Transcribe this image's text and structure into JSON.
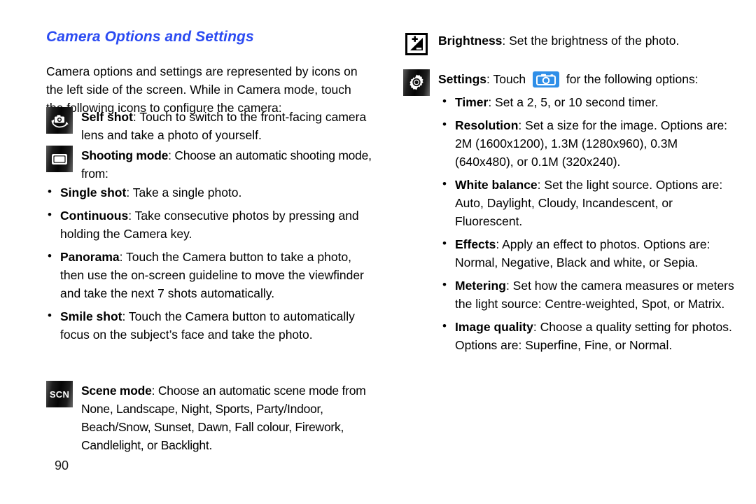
{
  "document": {
    "heading": "Camera Options and Settings",
    "page_number": "90"
  },
  "left_column": {
    "intro": "Camera options and settings are represented by icons on the left side of the screen. While in Camera mode, touch the following icons to configure the camera:",
    "entries": [
      {
        "icon": "self-shot-camera-icon",
        "term": "Self shot",
        "description": ": Touch to switch to the front-facing camera lens and take a photo of yourself."
      },
      {
        "icon": "shooting-mode-icon",
        "term": "Shooting mode",
        "description": ": Choose an automatic shooting mode, from:"
      }
    ],
    "shooting_mode_bullets": [
      {
        "term": "Single shot",
        "description": ": Take a single photo."
      },
      {
        "term": "Continuous",
        "description": ": Take consecutive photos by pressing and holding the Camera key."
      },
      {
        "term": "Panorama",
        "description": ": Touch the Camera button to take a photo, then use the on-screen guideline to move the viewfinder and take the next 7 shots automatically."
      },
      {
        "term": "Smile shot",
        "description": ": Touch the Camera button to automatically focus on the subject’s face and take the photo."
      }
    ],
    "scene_mode": {
      "icon": "scene-mode-scn-icon",
      "icon_label": "SCN",
      "term": "Scene mode",
      "description": ": Choose an automatic scene mode from None, Landscape, Night, Sports, Party/Indoor, Beach/Snow, Sunset, Dawn, Fall colour, Firework, Candlelight, or Backlight."
    }
  },
  "right_column": {
    "brightness": {
      "icon": "brightness-icon",
      "term": "Brightness",
      "description": ": Set the brightness of the photo."
    },
    "settings": {
      "icon": "settings-gear-icon",
      "term": "Settings",
      "text_before": ": Touch",
      "inline_icon": "blue-camera-icon",
      "text_after": "for the following options:"
    },
    "settings_bullets": [
      {
        "term": "Timer",
        "description": ": Set a 2, 5, or 10 second timer."
      },
      {
        "term": "Resolution",
        "description": ": Set a size for the image. Options are: 2M (1600x1200), 1.3M (1280x960), 0.3M (640x480), or 0.1M (320x240)."
      },
      {
        "term": "White balance",
        "description": ": Set the light source. Options are: Auto, Daylight, Cloudy, Incandescent, or Fluorescent."
      },
      {
        "term": "Effects",
        "description": ": Apply an effect to photos. Options are: Normal, Negative, Black and white, or Sepia."
      },
      {
        "term": "Metering",
        "description": ": Set how the camera measures or meters the light source: Centre-weighted, Spot, or Matrix."
      },
      {
        "term": "Image quality",
        "description": ": Choose a quality setting for photos. Options are: Superfine, Fine, or Normal."
      }
    ]
  },
  "colors": {
    "heading": "#2b4bf2",
    "text": "#000000",
    "inline_icon_bg": "#2f8fe8",
    "chip_dark": "#050505"
  }
}
